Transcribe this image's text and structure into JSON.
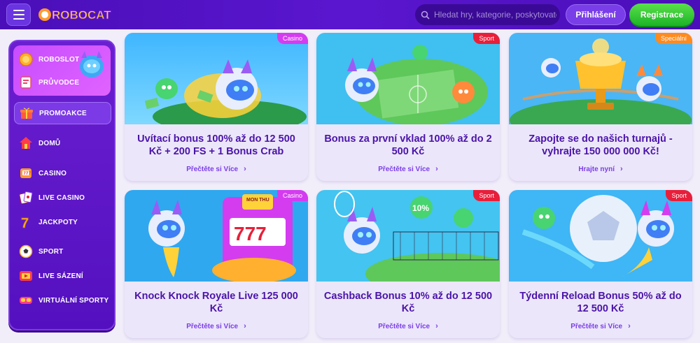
{
  "header": {
    "logo_text": "ROBOCAT",
    "search_placeholder": "Hledat hry, kategorie, poskytovatele",
    "login_label": "Přihlášení",
    "register_label": "Registrace"
  },
  "sidebar": {
    "top_items": [
      {
        "label": "ROBOSLOT",
        "icon": "coin-slot-icon"
      },
      {
        "label": "PRŮVODCE",
        "icon": "guide-icon"
      }
    ],
    "items": [
      {
        "label": "PROMOAKCE",
        "icon": "gift-icon"
      },
      {
        "label": "DOMŮ",
        "icon": "home-icon"
      },
      {
        "label": "CASINO",
        "icon": "casino-icon"
      },
      {
        "label": "LIVE CASINO",
        "icon": "cards-icon"
      },
      {
        "label": "JACKPOTY",
        "icon": "seven-icon"
      },
      {
        "label": "SPORT",
        "icon": "soccer-ball-icon"
      },
      {
        "label": "LIVE SÁZENÍ",
        "icon": "live-bet-icon"
      },
      {
        "label": "VIRTUÁLNÍ SPORTY",
        "icon": "vr-headset-icon"
      }
    ]
  },
  "cards": [
    {
      "tag": "Casino",
      "title": "Uvítací bonus 100% až do 12 500 Kč + 200 FS + 1 Bonus Crab",
      "link": "Přečtěte si Více"
    },
    {
      "tag": "Sport",
      "title": "Bonus za první vklad 100% až do 2 500 Kč",
      "link": "Přečtěte si Více"
    },
    {
      "tag": "Speciální",
      "title": "Zapojte se do našich turnajů - vyhrajte 150 000 000 Kč!",
      "link": "Hrajte nyní"
    },
    {
      "tag": "Casino",
      "title": "Knock Knock Royale Live 125 000 Kč",
      "link": "Přečtěte si Více"
    },
    {
      "tag": "Sport",
      "title": "Cashback Bonus 10% až do 12 500 Kč",
      "link": "Přečtěte si Více"
    },
    {
      "tag": "Sport",
      "title": "Týdenní Reload Bonus 50% až do 12 500 Kč",
      "link": "Přečtěte si Více"
    }
  ],
  "card_art": {
    "slot_sign": "MON THU",
    "slot_reels": "777",
    "cashback_badge": "10%"
  },
  "colors": {
    "header_bg": "#5213c6",
    "sidebar_bg": "#6a1fd0",
    "accent_green": "#1cb327",
    "title_purple": "#4a14a8",
    "tag_red": "#e81f3a",
    "tag_pink": "#d43cf0"
  }
}
